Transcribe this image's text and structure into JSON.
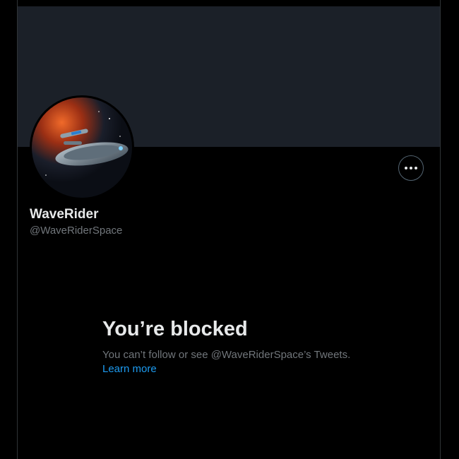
{
  "profile": {
    "display_name": "WaveRider",
    "handle": "@WaveRiderSpace",
    "avatar_icon": "starship-avatar-icon",
    "more_icon": "more-options-icon"
  },
  "blocked": {
    "title": "You’re blocked",
    "description": "You can’t follow or see @WaveRiderSpace’s Tweets.",
    "link": "Learn more"
  },
  "colors": {
    "background": "#000000",
    "banner": "#1b2028",
    "primary_text": "#e7e9ea",
    "secondary_text": "#71767b",
    "link": "#1d9bf0",
    "border": "#2f3336"
  }
}
